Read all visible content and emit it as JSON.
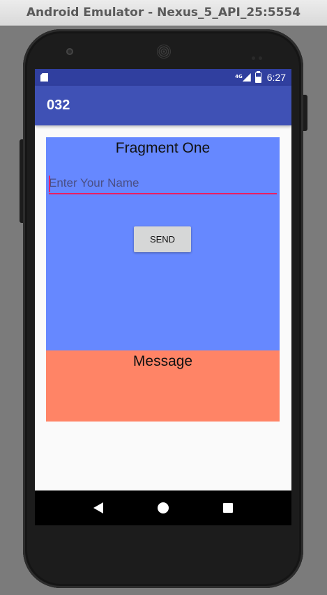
{
  "window": {
    "title": "Android Emulator - Nexus_5_API_25:5554"
  },
  "status_bar": {
    "network": "4G",
    "time": "6:27",
    "sd_icon": "sd-card-icon",
    "signal_icon": "signal-icon",
    "battery_icon": "battery-icon"
  },
  "app_bar": {
    "title": "032",
    "color": "#3f51b5"
  },
  "fragment_one": {
    "title": "Fragment One",
    "name_input": {
      "value": "",
      "placeholder": "Enter Your Name"
    },
    "send_label": "SEND",
    "color": "#6688ff"
  },
  "fragment_two": {
    "message": "Message",
    "color": "#ff8466"
  },
  "nav_bar": {
    "back_icon": "back-icon",
    "home_icon": "home-icon",
    "recents_icon": "recents-icon"
  }
}
